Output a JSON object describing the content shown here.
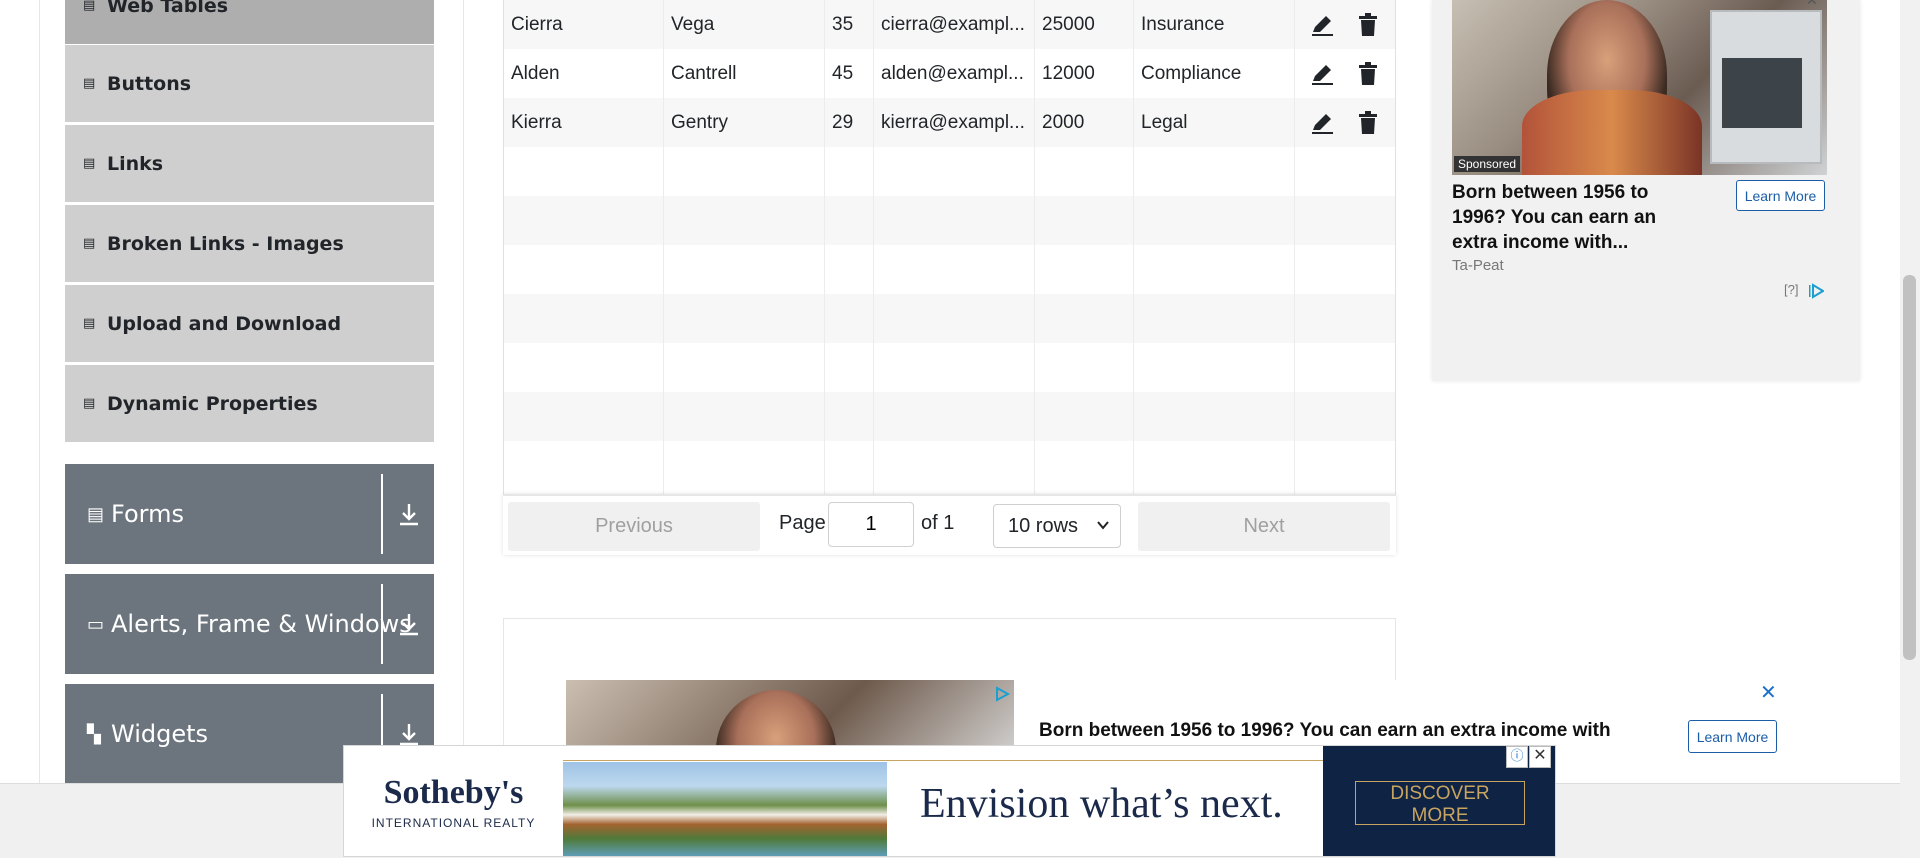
{
  "sidebar": {
    "elements": [
      {
        "label": "Web Tables",
        "icon": "html5-icon"
      },
      {
        "label": "Buttons",
        "icon": "html5-icon"
      },
      {
        "label": "Links",
        "icon": "html5-icon"
      },
      {
        "label": "Broken Links - Images",
        "icon": "html5-icon"
      },
      {
        "label": "Upload and Download",
        "icon": "html5-icon"
      },
      {
        "label": "Dynamic Properties",
        "icon": "html5-icon"
      }
    ],
    "groups": [
      {
        "label": "Forms",
        "icon": "form-icon"
      },
      {
        "label": "Alerts, Frame & Windows",
        "icon": "window-icon"
      },
      {
        "label": "Widgets",
        "icon": "widgets-icon"
      }
    ]
  },
  "table": {
    "rows": [
      {
        "first": "Cierra",
        "last": "Vega",
        "age": "35",
        "email": "cierra@exampl...",
        "salary": "25000",
        "department": "Insurance"
      },
      {
        "first": "Alden",
        "last": "Cantrell",
        "age": "45",
        "email": "alden@exampl...",
        "salary": "12000",
        "department": "Compliance"
      },
      {
        "first": "Kierra",
        "last": "Gentry",
        "age": "29",
        "email": "kierra@exampl...",
        "salary": "2000",
        "department": "Legal"
      }
    ]
  },
  "pagination": {
    "previous": "Previous",
    "page_label": "Page",
    "page_value": "1",
    "of_label": "of 1",
    "rows_select": "10 rows",
    "next": "Next"
  },
  "side_ad": {
    "sponsored": "Sponsored",
    "title": "Born between 1956 to 1996? You can earn an extra income with...",
    "learn_more": "Learn More",
    "brand": "Ta-Peat",
    "help": "[?]"
  },
  "inline_ad": {
    "headline": "Born between 1956 to 1996? You can earn an extra income with",
    "learn_more": "Learn More",
    "close": "✕"
  },
  "banner_ad": {
    "brand": "Sotheby's",
    "brand_sub": "INTERNATIONAL REALTY",
    "tagline": "Envision what’s next.",
    "cta": "DISCOVER MORE"
  },
  "colors": {
    "group_bg": "#6c757d",
    "element_bg": "#cfcfcf",
    "active_element_bg": "#aeaeae",
    "link_blue": "#1a5ea8"
  }
}
